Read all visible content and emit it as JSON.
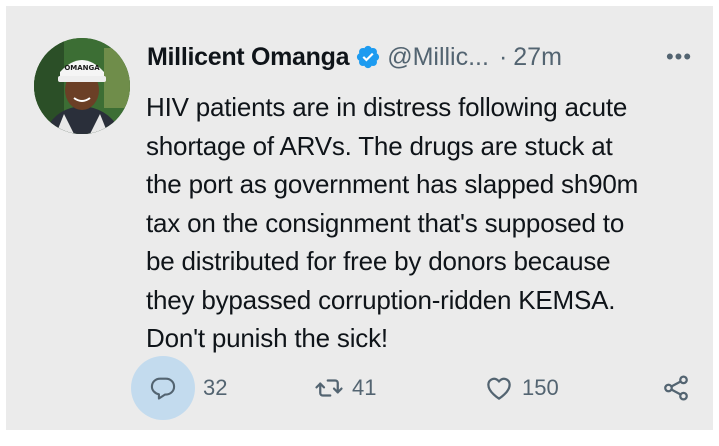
{
  "tweet": {
    "author_name": "Millicent Omanga",
    "handle": "@Millic...",
    "separator": "·",
    "time_ago": "27m",
    "verified": true,
    "more_label": "•••",
    "lines": [
      "HIV patients are in distress following acute",
      "shortage of ARVs. The drugs are stuck at",
      "the port as government has slapped sh90m",
      "tax on the consignment that's supposed to",
      "be distributed for free by donors because",
      "they bypassed corruption-ridden KEMSA.",
      "Don't punish the sick!"
    ],
    "avatar_cap_text": "OMANGA"
  },
  "actions": {
    "reply_count": "32",
    "retweet_count": "41",
    "like_count": "150"
  },
  "colors": {
    "background": "#ebebeb",
    "text": "#0f1419",
    "secondary": "#536471",
    "verified_blue": "#1d9bf0",
    "reply_highlight": "#c3dbee"
  },
  "icons": [
    "verified-badge-icon",
    "more-icon",
    "reply-icon",
    "retweet-icon",
    "like-icon",
    "share-icon"
  ]
}
